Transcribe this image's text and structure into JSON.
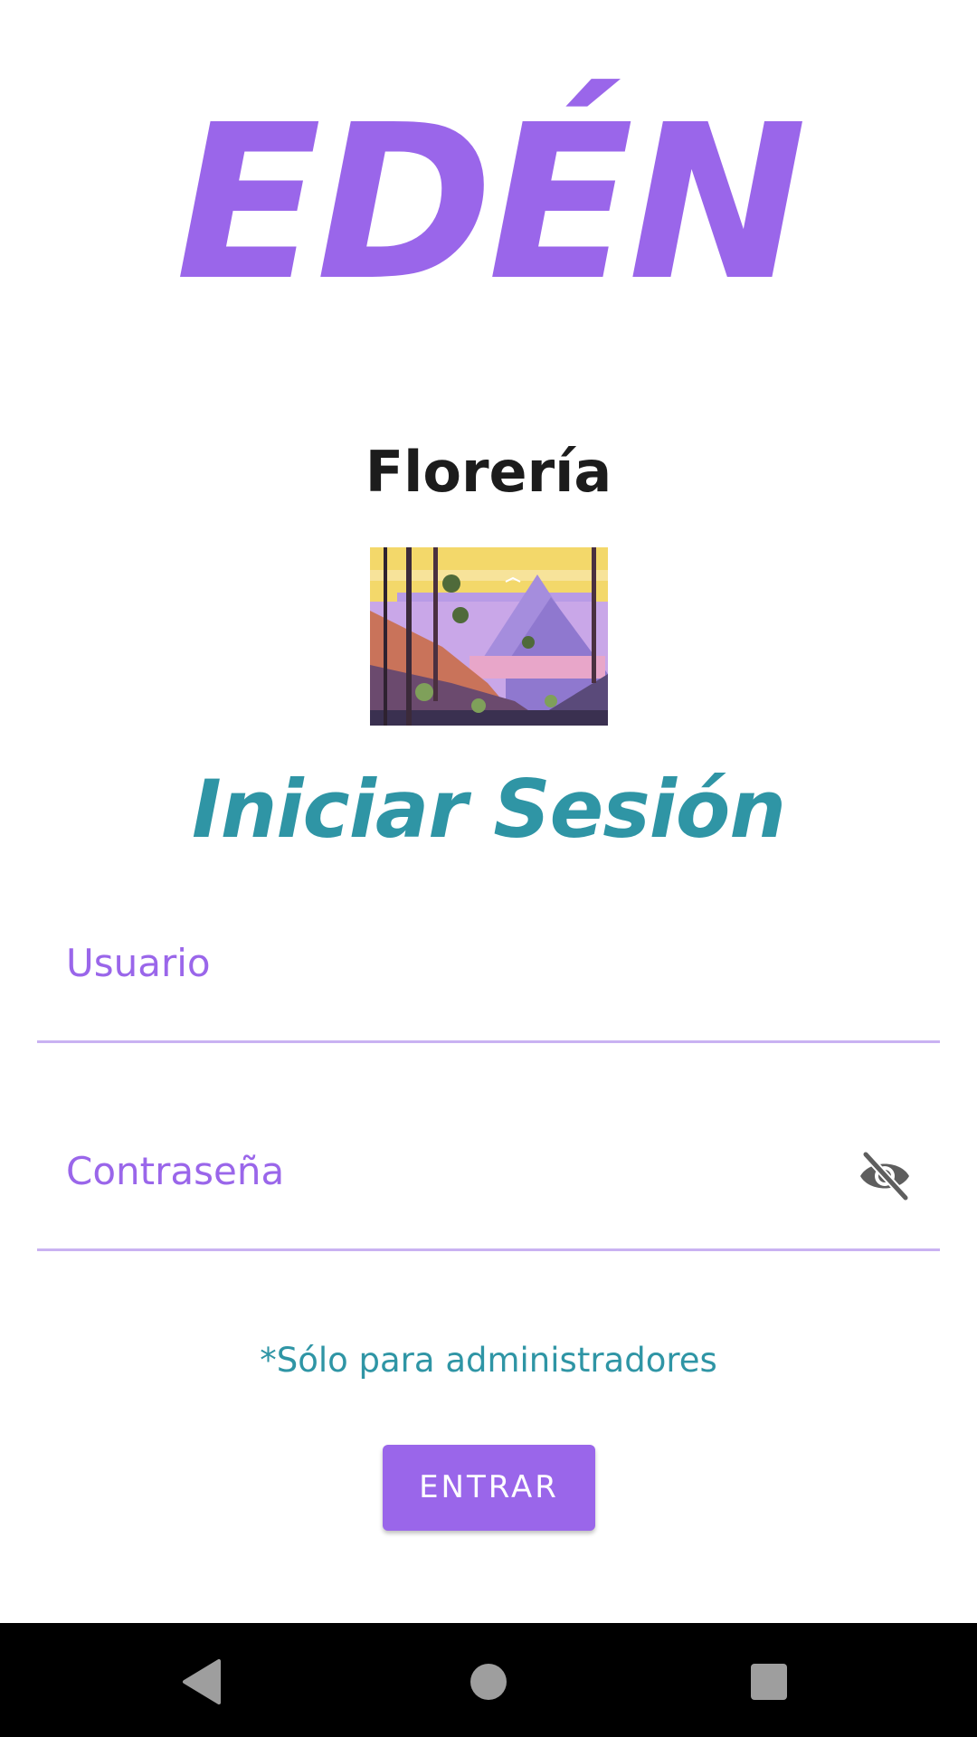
{
  "header": {
    "brand": "EDÉN",
    "subtitle": "Florería"
  },
  "login": {
    "title": "Iniciar Sesión",
    "username": {
      "label": "Usuario",
      "value": ""
    },
    "password": {
      "label": "Contraseña",
      "value": "",
      "visibility_icon": "visibility-off-icon"
    },
    "note": "*Sólo para administradores",
    "submit_label": "ENTRAR"
  },
  "navigation_bar": {
    "items": [
      "back-icon",
      "home-icon",
      "recents-icon"
    ]
  },
  "colors": {
    "primary": "#9a66ea",
    "accent_teal": "#2f95a5",
    "field_underline": "#c9b2f2",
    "text_dark": "#1c1c1c",
    "nav_bar": "#000000"
  }
}
